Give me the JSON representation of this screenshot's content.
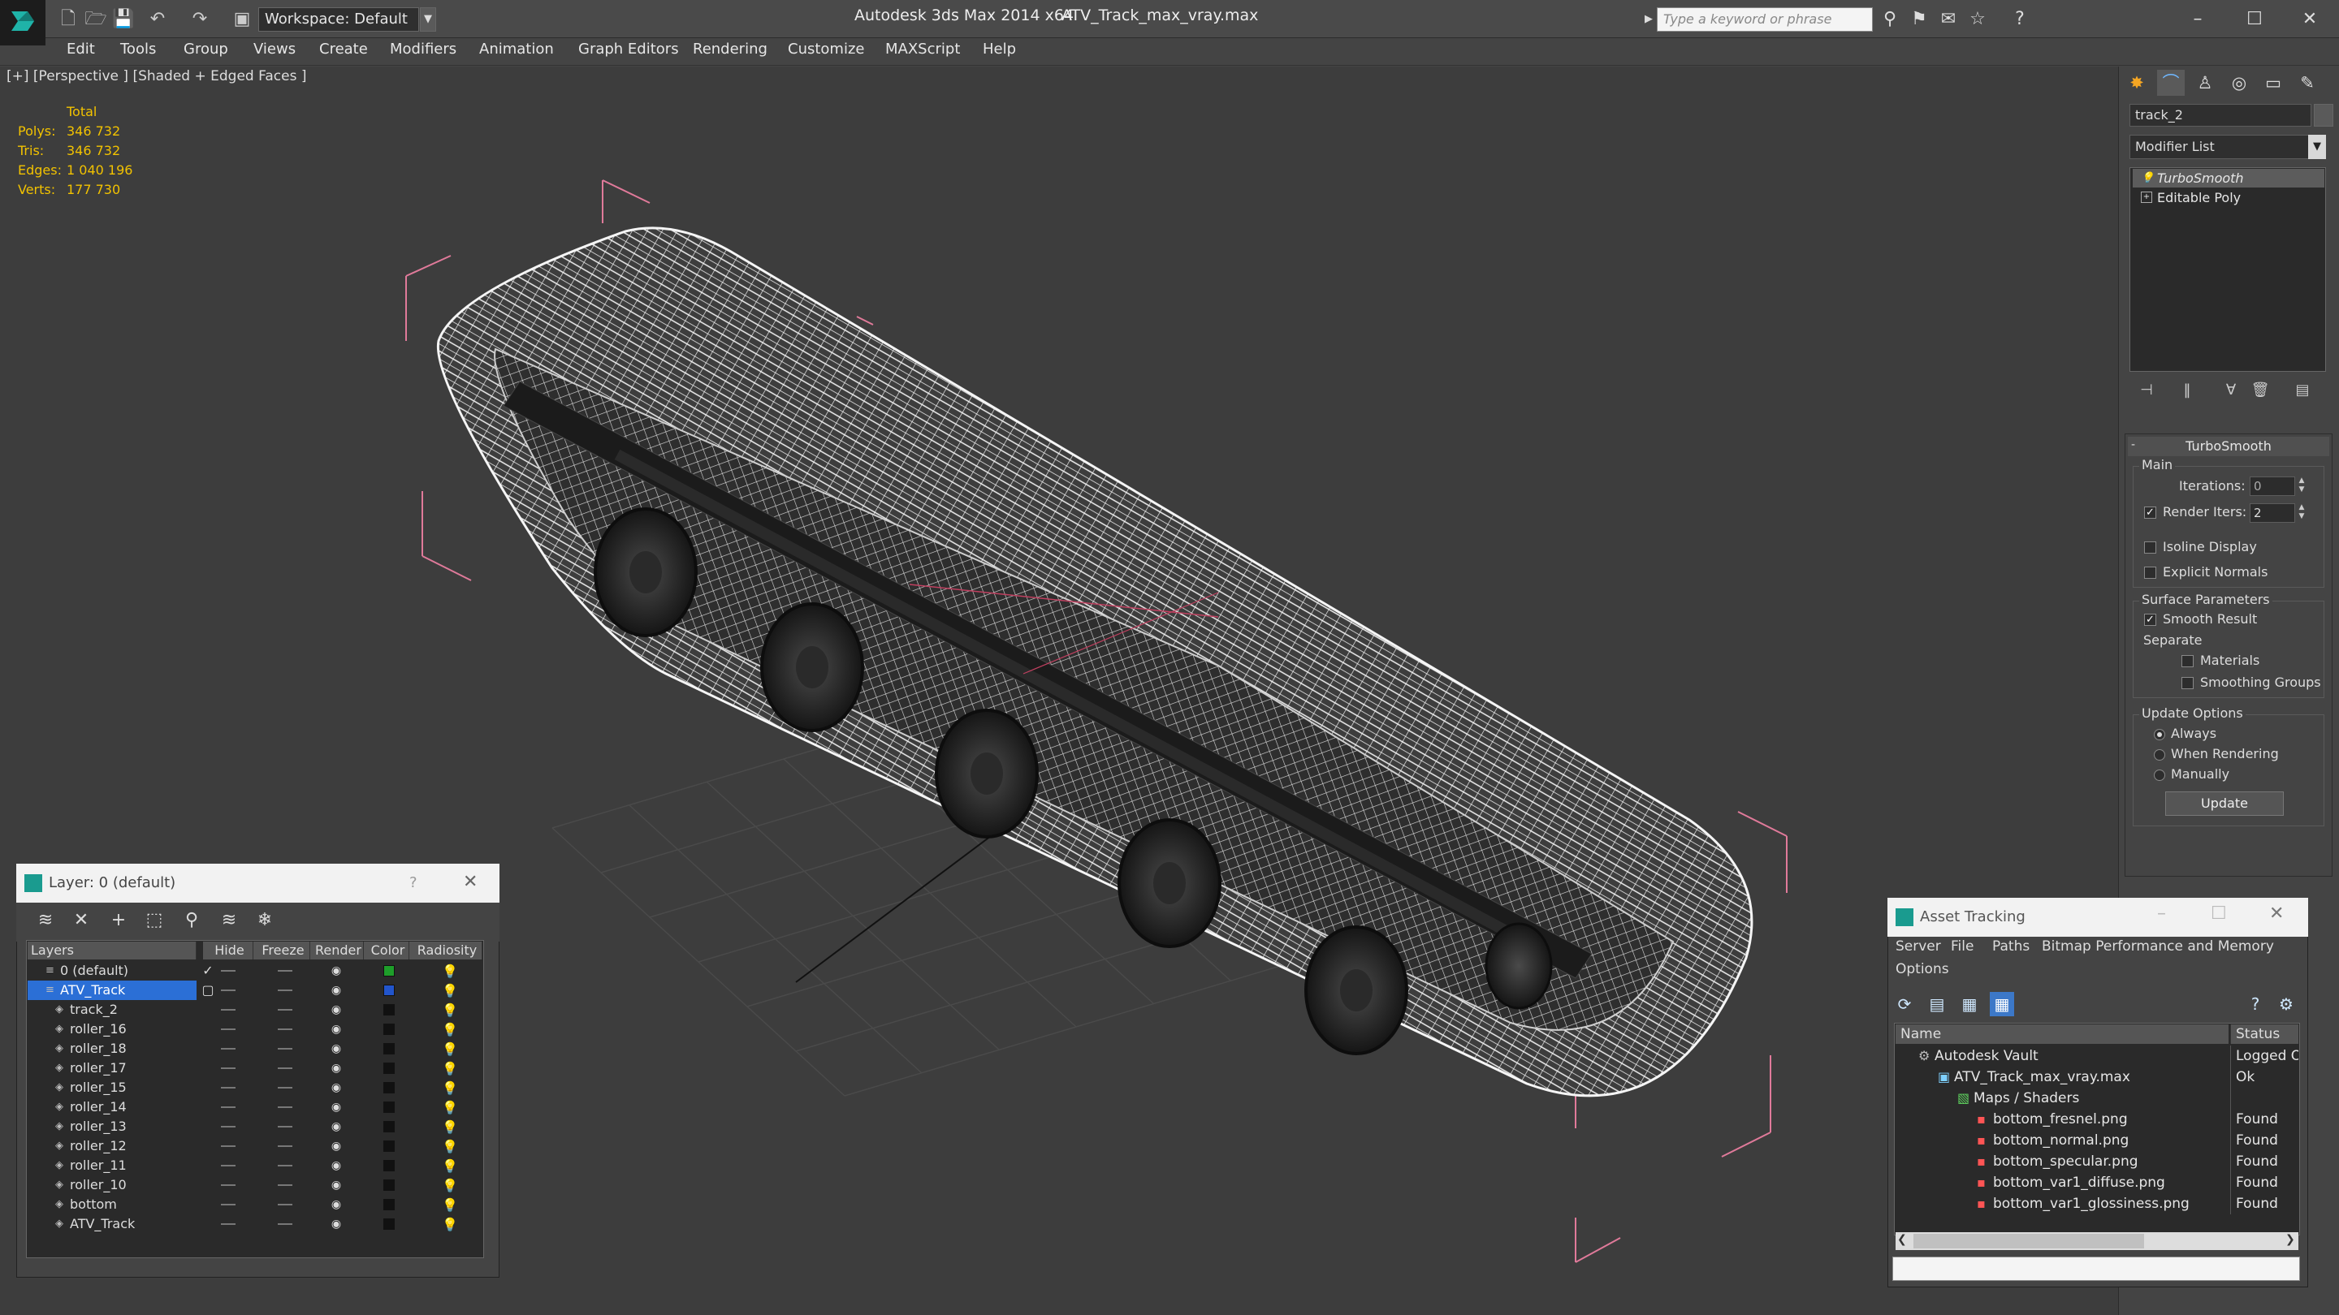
{
  "app": {
    "title": "Autodesk 3ds Max  2014 x64",
    "file": "ATV_Track_max_vray.max",
    "workspace": "Workspace: Default",
    "search_placeholder": "Type a keyword or phrase"
  },
  "menu": [
    "Edit",
    "Tools",
    "Group",
    "Views",
    "Create",
    "Modifiers",
    "Animation",
    "Graph Editors",
    "Rendering",
    "Customize",
    "MAXScript",
    "Help"
  ],
  "viewport": {
    "label": "[+] [Perspective ] [Shaded + Edged Faces ]",
    "stats": {
      "header": "Total",
      "rows": [
        {
          "label": "Polys:",
          "value": "346 732"
        },
        {
          "label": "Tris:",
          "value": "346 732"
        },
        {
          "label": "Edges:",
          "value": "1 040 196"
        },
        {
          "label": "Verts:",
          "value": "177 730"
        }
      ]
    }
  },
  "command_panel": {
    "object_name": "track_2",
    "modifier_list": "Modifier List",
    "stack": [
      "TurboSmooth",
      "Editable Poly"
    ],
    "rollout_title": "TurboSmooth",
    "main_group": "Main",
    "iterations_label": "Iterations:",
    "iterations_value": "0",
    "render_iters_label": "Render Iters:",
    "render_iters_value": "2",
    "render_iters_checked": true,
    "isoline_label": "Isoline Display",
    "isoline_checked": false,
    "explicit_normals_label": "Explicit Normals",
    "explicit_normals_checked": false,
    "surface_group": "Surface Parameters",
    "smooth_result_label": "Smooth Result",
    "smooth_result_checked": true,
    "separate_label": "Separate",
    "materials_label": "Materials",
    "materials_checked": false,
    "smoothing_groups_label": "Smoothing Groups",
    "smoothing_groups_checked": false,
    "update_group": "Update Options",
    "update_options": [
      "Always",
      "When Rendering",
      "Manually"
    ],
    "update_selected": "Always",
    "update_button": "Update"
  },
  "layer_dialog": {
    "title": "Layer: 0 (default)",
    "help": "?",
    "columns": [
      "Layers",
      "Hide",
      "Freeze",
      "Render",
      "Color",
      "Radiosity"
    ],
    "rows": [
      {
        "name": "0 (default)",
        "indent": 0,
        "color": "#1e9e2a",
        "current": true,
        "selected": false
      },
      {
        "name": "ATV_Track",
        "indent": 0,
        "color": "#2255cc",
        "current": false,
        "selected": true
      },
      {
        "name": "track_2",
        "indent": 1,
        "color": "#111111",
        "current": false,
        "selected": false
      },
      {
        "name": "roller_16",
        "indent": 1,
        "color": "#111111",
        "current": false,
        "selected": false
      },
      {
        "name": "roller_18",
        "indent": 1,
        "color": "#111111",
        "current": false,
        "selected": false
      },
      {
        "name": "roller_17",
        "indent": 1,
        "color": "#111111",
        "current": false,
        "selected": false
      },
      {
        "name": "roller_15",
        "indent": 1,
        "color": "#111111",
        "current": false,
        "selected": false
      },
      {
        "name": "roller_14",
        "indent": 1,
        "color": "#111111",
        "current": false,
        "selected": false
      },
      {
        "name": "roller_13",
        "indent": 1,
        "color": "#111111",
        "current": false,
        "selected": false
      },
      {
        "name": "roller_12",
        "indent": 1,
        "color": "#111111",
        "current": false,
        "selected": false
      },
      {
        "name": "roller_11",
        "indent": 1,
        "color": "#111111",
        "current": false,
        "selected": false
      },
      {
        "name": "roller_10",
        "indent": 1,
        "color": "#111111",
        "current": false,
        "selected": false
      },
      {
        "name": "bottom",
        "indent": 1,
        "color": "#111111",
        "current": false,
        "selected": false
      },
      {
        "name": "ATV_Track",
        "indent": 1,
        "color": "#111111",
        "current": false,
        "selected": false
      }
    ]
  },
  "asset_dialog": {
    "title": "Asset Tracking",
    "menu": [
      "Server",
      "File",
      "Paths",
      "Bitmap Performance and Memory",
      "Options"
    ],
    "columns": [
      "Name",
      "Status"
    ],
    "rows": [
      {
        "name": "Autodesk Vault",
        "indent": 0,
        "status": "Logged O",
        "icon": "vault"
      },
      {
        "name": "ATV_Track_max_vray.max",
        "indent": 1,
        "status": "Ok",
        "icon": "max-file"
      },
      {
        "name": "Maps / Shaders",
        "indent": 2,
        "status": "",
        "icon": "maps"
      },
      {
        "name": "bottom_fresnel.png",
        "indent": 3,
        "status": "Found",
        "icon": "png"
      },
      {
        "name": "bottom_normal.png",
        "indent": 3,
        "status": "Found",
        "icon": "png"
      },
      {
        "name": "bottom_specular.png",
        "indent": 3,
        "status": "Found",
        "icon": "png"
      },
      {
        "name": "bottom_var1_diffuse.png",
        "indent": 3,
        "status": "Found",
        "icon": "png"
      },
      {
        "name": "bottom_var1_glossiness.png",
        "indent": 3,
        "status": "Found",
        "icon": "png"
      }
    ]
  }
}
